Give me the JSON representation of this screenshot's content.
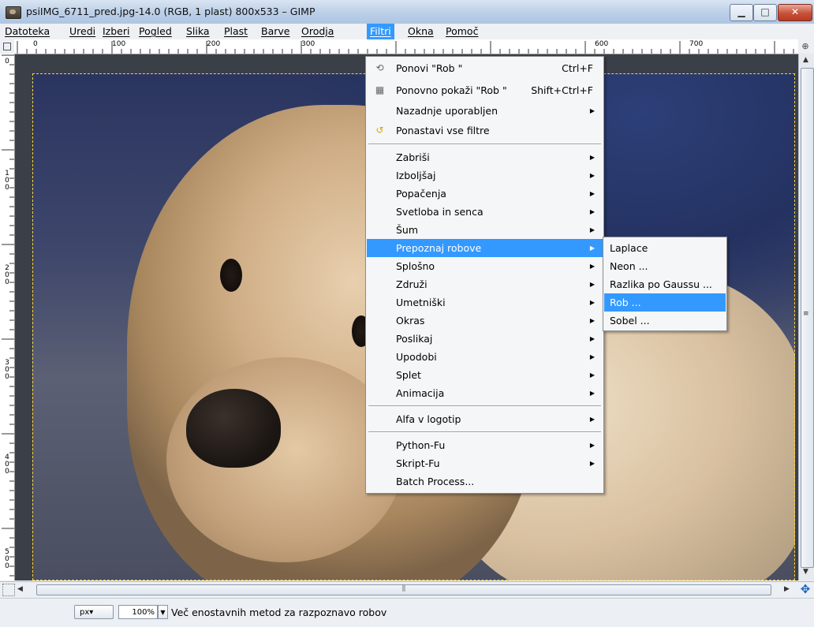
{
  "window": {
    "title": "psiIMG_6711_pred.jpg-14.0 (RGB, 1 plast) 800x533 – GIMP",
    "min_symbol": "▁",
    "max_symbol": "□",
    "close_symbol": "✕"
  },
  "menubar": {
    "items": [
      "Datoteka",
      "Uredi",
      "Izberi",
      "Pogled",
      "Slika",
      "Plast",
      "Barve",
      "Orodja",
      "Filtri",
      "Okna",
      "Pomoč"
    ],
    "active": "Filtri"
  },
  "rulers": {
    "horizontal": [
      "0",
      "100",
      "200",
      "300",
      "600",
      "700"
    ],
    "vertical": [
      "0",
      "100",
      "200",
      "300",
      "400",
      "500"
    ]
  },
  "filters_menu": {
    "items": [
      {
        "label": "Ponovi \"Rob \"",
        "shortcut": "Ctrl+F",
        "icon": "repeat-icon"
      },
      {
        "label": "Ponovno pokaži \"Rob \"",
        "shortcut": "Shift+Ctrl+F",
        "icon": "reshow-icon"
      },
      {
        "label": "Nazadnje uporabljen",
        "submenu": true
      },
      {
        "label": "Ponastavi vse filtre",
        "icon": "reset-icon"
      },
      {
        "label": "Zabriši",
        "submenu": true
      },
      {
        "label": "Izboljšaj",
        "submenu": true
      },
      {
        "label": "Popačenja",
        "submenu": true
      },
      {
        "label": "Svetloba in senca",
        "submenu": true
      },
      {
        "label": "Šum",
        "submenu": true
      },
      {
        "label": "Prepoznaj robove",
        "submenu": true,
        "highlighted": true
      },
      {
        "label": "Splošno",
        "submenu": true
      },
      {
        "label": "Združi",
        "submenu": true
      },
      {
        "label": "Umetniški",
        "submenu": true
      },
      {
        "label": "Okras",
        "submenu": true
      },
      {
        "label": "Poslikaj",
        "submenu": true
      },
      {
        "label": "Upodobi",
        "submenu": true
      },
      {
        "label": "Splet",
        "submenu": true
      },
      {
        "label": "Animacija",
        "submenu": true
      },
      {
        "label": "Alfa v logotip",
        "submenu": true
      },
      {
        "label": "Python-Fu",
        "submenu": true
      },
      {
        "label": "Skript-Fu",
        "submenu": true
      },
      {
        "label": "Batch Process..."
      }
    ],
    "arrow": "▶"
  },
  "edge_submenu": {
    "items": [
      "Laplace",
      "Neon ...",
      "Razlika po Gaussu ...",
      "Rob ...",
      "Sobel ..."
    ],
    "highlighted": "Rob ..."
  },
  "statusbar": {
    "unit": "px▾",
    "zoom": "100%",
    "zoom_arrow": "▼",
    "message": "Več enostavnih metod za razpoznavo robov"
  },
  "scroll": {
    "up": "▲",
    "down": "▼",
    "left": "◀",
    "right": "▶",
    "grip": "≡",
    "hgrip": "⫼"
  },
  "icons": {
    "navigate": "✥",
    "zoom": "⊕"
  },
  "colors": {
    "menu_highlight": "#3399ff",
    "selection_border": "#ffd23a"
  }
}
